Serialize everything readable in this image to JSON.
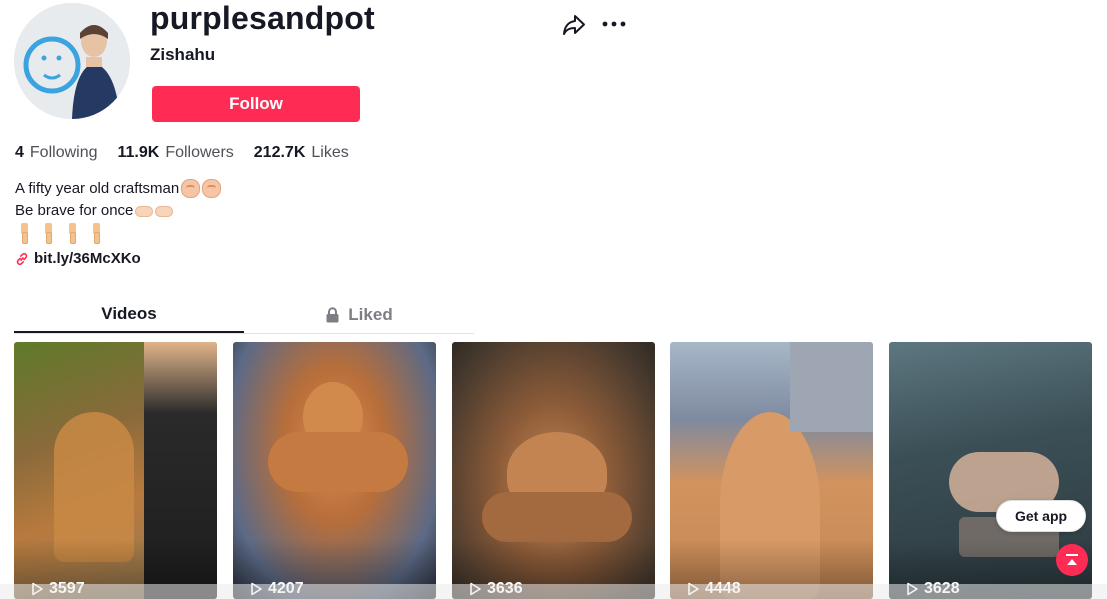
{
  "profile": {
    "username": "purplesandpot",
    "nickname": "Zishahu",
    "follow_label": "Follow",
    "avatar_icon": "avatar-image"
  },
  "stats": [
    {
      "value": "4",
      "label": "Following"
    },
    {
      "value": "11.9K",
      "label": "Followers"
    },
    {
      "value": "212.7K",
      "label": "Likes"
    }
  ],
  "bio": {
    "line1": "A fifty year old craftsman",
    "line2": "Be brave for once",
    "link": "bit.ly/36McXKo"
  },
  "tabs": {
    "videos": "Videos",
    "liked": "Liked"
  },
  "videos": [
    {
      "views": "3597"
    },
    {
      "views": "4207"
    },
    {
      "views": "3636"
    },
    {
      "views": "4448"
    },
    {
      "views": "3628"
    }
  ],
  "floating": {
    "get_app": "Get app"
  },
  "colors": {
    "accent": "#fe2c55",
    "text": "#161823",
    "muted": "#7d7e84"
  }
}
